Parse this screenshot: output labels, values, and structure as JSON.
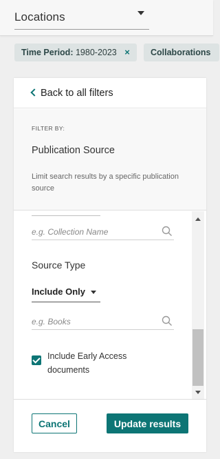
{
  "locations": {
    "label": "Locations"
  },
  "chips": [
    {
      "label": "Time Period:",
      "value": "1980-2023",
      "close": "×"
    },
    {
      "label": "Collaborations"
    }
  ],
  "panel": {
    "back_label": "Back to all filters",
    "filter_by": "FILTER BY:",
    "title": "Publication Source",
    "description": "Limit search results by a specific publication source",
    "collection_search": {
      "placeholder": "e.g. Collection Name"
    },
    "source_type_title": "Source Type",
    "include_dropdown": {
      "selected": "Include Only"
    },
    "books_search": {
      "placeholder": "e.g. Books"
    },
    "early_access": {
      "label": "Include Early Access documents",
      "checked": true
    },
    "cancel_label": "Cancel",
    "update_label": "Update results"
  },
  "colors": {
    "accent": "#0d7575",
    "chip_bg": "#dde3e3"
  },
  "icons": [
    "chevron-left-icon",
    "search-icon",
    "close-icon",
    "caret-down-icon"
  ]
}
